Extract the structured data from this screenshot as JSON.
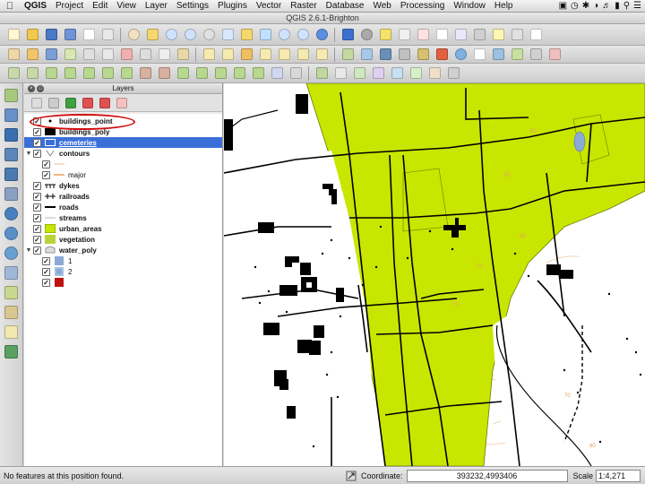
{
  "menubar": {
    "app_name": "QGIS",
    "items": [
      "Project",
      "Edit",
      "View",
      "Layer",
      "Settings",
      "Plugins",
      "Vector",
      "Raster",
      "Database",
      "Web",
      "Processing",
      "Window",
      "Help"
    ]
  },
  "window": {
    "title": "QGIS 2.6.1-Brighton"
  },
  "layers_panel": {
    "title": "Layers",
    "layers": [
      {
        "label": "buildings_point",
        "checked": true
      },
      {
        "label": "buildings_poly",
        "checked": true
      },
      {
        "label": "cemeteries",
        "checked": true,
        "selected": true
      },
      {
        "label": "contours",
        "checked": true,
        "expanded": true,
        "children": [
          "",
          "major"
        ]
      },
      {
        "label": "dykes",
        "checked": true
      },
      {
        "label": "railroads",
        "checked": true
      },
      {
        "label": "roads",
        "checked": true
      },
      {
        "label": "streams",
        "checked": true
      },
      {
        "label": "urban_areas",
        "checked": true
      },
      {
        "label": "vegetation",
        "checked": true
      },
      {
        "label": "water_poly",
        "checked": true,
        "expanded": true,
        "children": [
          "1",
          "2",
          ""
        ]
      }
    ]
  },
  "statusbar": {
    "message": "No features at this position found.",
    "coordinate_label": "Coordinate:",
    "coordinate_value": "393232,4993406",
    "scale_label": "Scale",
    "scale_value": "1:4,271"
  },
  "colors": {
    "urban_green": "#c8e600",
    "vegetation_green": "#b5d43a",
    "water_blue": "#8aa9d6",
    "selection_blue": "#3a6fd8",
    "highlight_red": "#d01010",
    "contour_orange": "#f0b070"
  }
}
